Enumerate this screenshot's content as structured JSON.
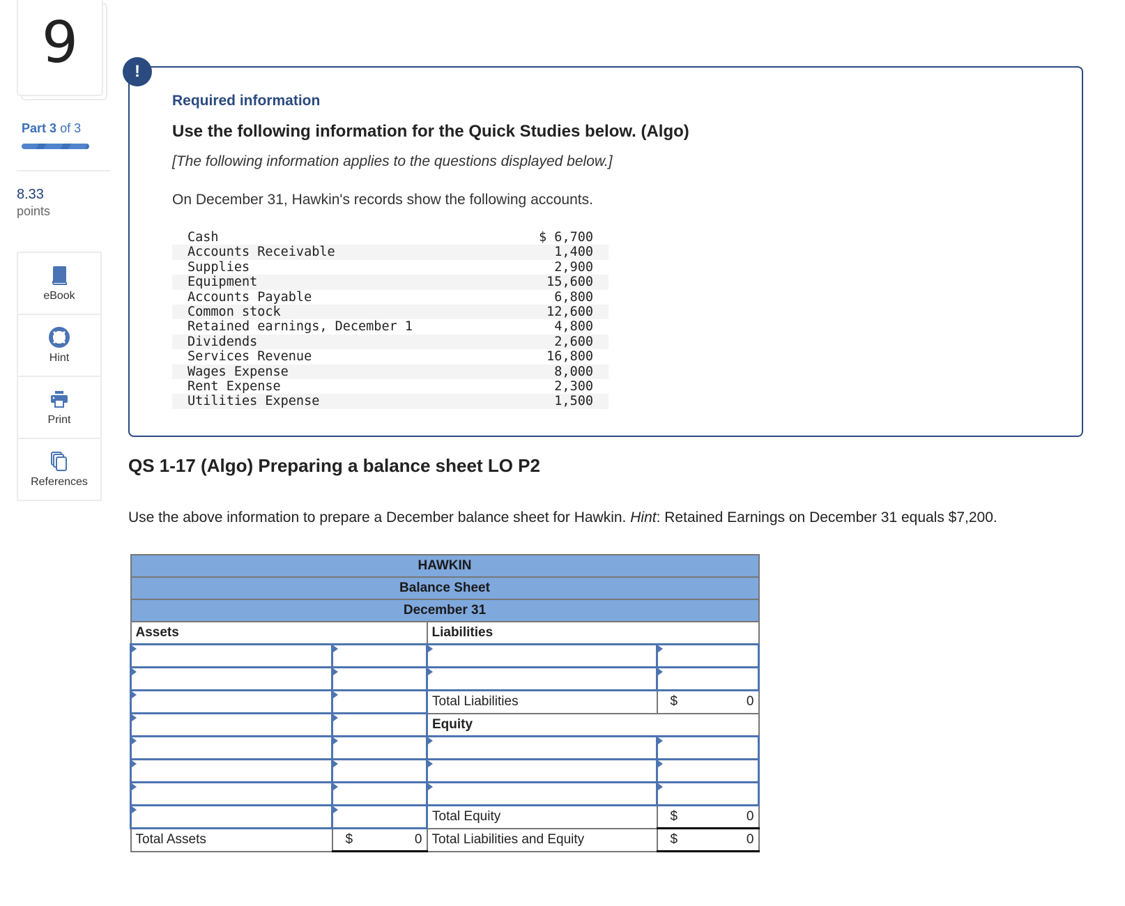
{
  "rail": {
    "question_number": "9",
    "part_label": "Part",
    "part_current": "3",
    "part_of": "of 3",
    "part_progress": 1.0,
    "points_value": "8.33",
    "points_label": "points",
    "tools": [
      {
        "label": "eBook",
        "icon": "book-icon"
      },
      {
        "label": "Hint",
        "icon": "lifebuoy-icon"
      },
      {
        "label": "Print",
        "icon": "printer-icon"
      },
      {
        "label": "References",
        "icon": "documents-icon"
      }
    ]
  },
  "info": {
    "badge": "!",
    "heading": "Required information",
    "title": "Use the following information for the Quick Studies below. (Algo)",
    "subtitle": "[The following information applies to the questions displayed below.]",
    "intro": "On December 31, Hawkin's records show the following accounts.",
    "accounts": [
      {
        "name": "Cash",
        "amount": "$ 6,700"
      },
      {
        "name": "Accounts Receivable",
        "amount": "1,400"
      },
      {
        "name": "Supplies",
        "amount": "2,900"
      },
      {
        "name": "Equipment",
        "amount": "15,600"
      },
      {
        "name": "Accounts Payable",
        "amount": "6,800"
      },
      {
        "name": "Common stock",
        "amount": "12,600"
      },
      {
        "name": "Retained earnings, December 1",
        "amount": "4,800"
      },
      {
        "name": "Dividends",
        "amount": "2,600"
      },
      {
        "name": "Services Revenue",
        "amount": "16,800"
      },
      {
        "name": "Wages Expense",
        "amount": "8,000"
      },
      {
        "name": "Rent Expense",
        "amount": "2,300"
      },
      {
        "name": "Utilities Expense",
        "amount": "1,500"
      }
    ]
  },
  "question": {
    "title": "QS 1-17 (Algo) Preparing a balance sheet LO P2",
    "prompt_before": "Use the above information to prepare a December balance sheet for Hawkin. ",
    "prompt_hint": "Hint",
    "prompt_after": ": Retained Earnings on December 31 equals $7,200."
  },
  "balance_sheet": {
    "company": "HAWKIN",
    "statement": "Balance Sheet",
    "date": "December 31",
    "assets_header": "Assets",
    "liabilities_header": "Liabilities",
    "equity_header": "Equity",
    "total_liabilities_label": "Total Liabilities",
    "total_liabilities_currency": "$",
    "total_liabilities_value": "0",
    "total_equity_label": "Total Equity",
    "total_equity_currency": "$",
    "total_equity_value": "0",
    "total_assets_label": "Total Assets",
    "total_assets_currency": "$",
    "total_assets_value": "0",
    "total_le_label": "Total Liabilities and Equity",
    "total_le_currency": "$",
    "total_le_value": "0"
  }
}
